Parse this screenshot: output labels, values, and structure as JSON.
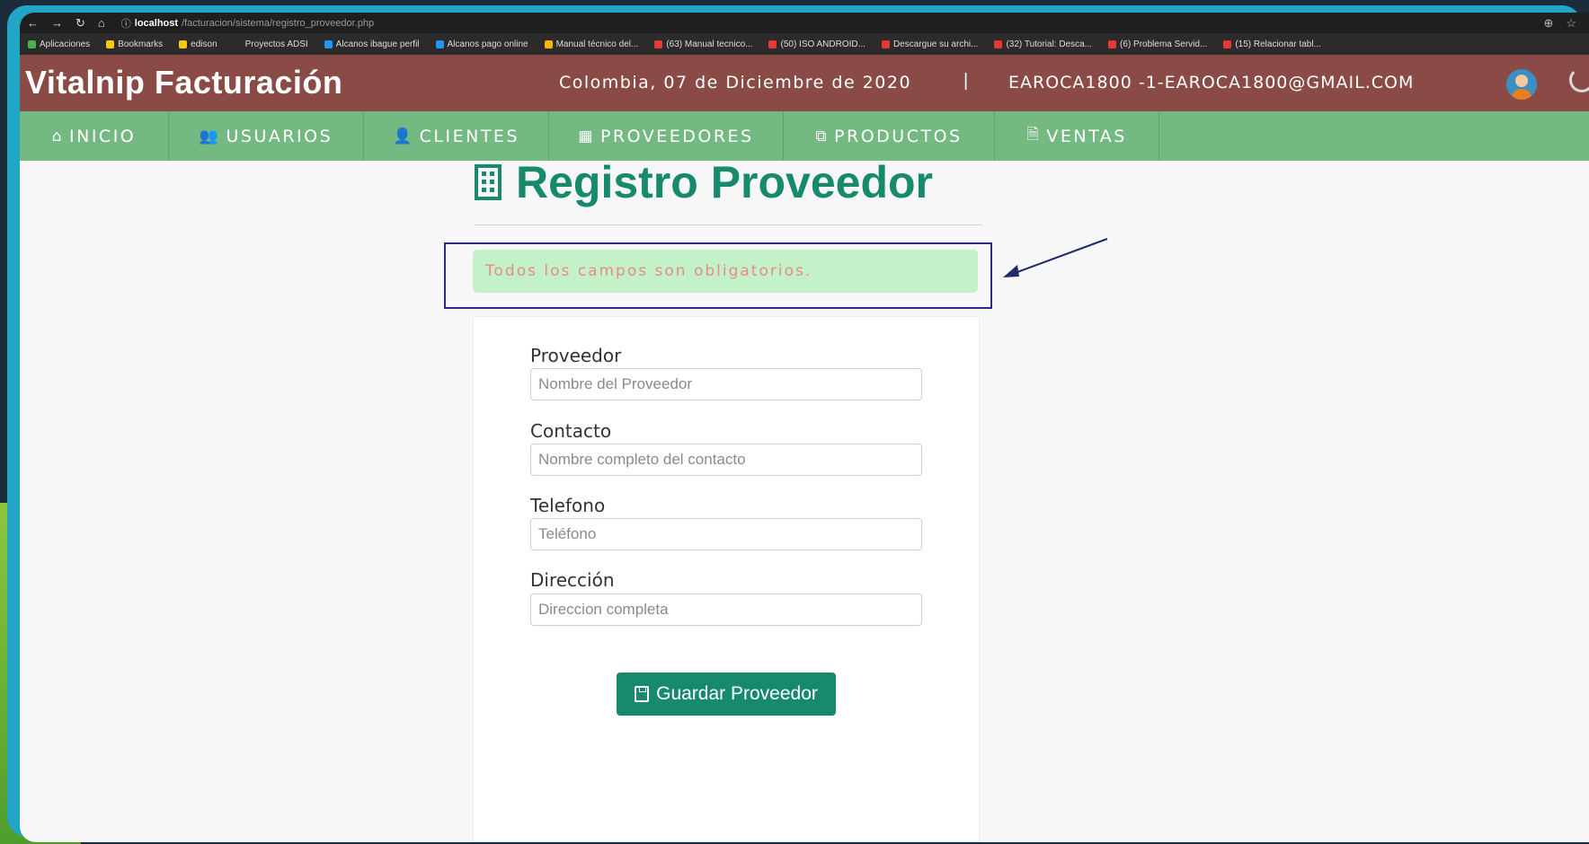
{
  "browser": {
    "host": "localhost",
    "path": "/facturacion/sistema/registro_proveedor.php",
    "bookmarks": [
      {
        "label": "Aplicaciones",
        "color": "#4caf50"
      },
      {
        "label": "Bookmarks",
        "color": "#f9c80e"
      },
      {
        "label": "edison",
        "color": "#f9c80e"
      },
      {
        "label": "Proyectos ADSI",
        "color": "#2b2b2b"
      },
      {
        "label": "Alcanos ibague perfil",
        "color": "#2196f3"
      },
      {
        "label": "Alcanos pago online",
        "color": "#2196f3"
      },
      {
        "label": "Manual técnico del...",
        "color": "#ffb300"
      },
      {
        "label": "(63) Manual tecnico...",
        "color": "#e53935"
      },
      {
        "label": "(50) ISO ANDROID...",
        "color": "#e53935"
      },
      {
        "label": "Descargue su archi...",
        "color": "#e53935"
      },
      {
        "label": "(32) Tutorial: Desca...",
        "color": "#e53935"
      },
      {
        "label": "(6) Problema Servid...",
        "color": "#e53935"
      },
      {
        "label": "(15) Relacionar tabl...",
        "color": "#e53935"
      }
    ]
  },
  "header": {
    "title": "Vitalnip Facturación",
    "date": "Colombia, 07 de Diciembre de 2020",
    "separator": "|",
    "user": "EAROCA1800 -1-EAROCA1800@GMAIL.COM"
  },
  "menu": [
    {
      "label": "INICIO",
      "icon": "home-icon",
      "glyph": "⌂"
    },
    {
      "label": "USUARIOS",
      "icon": "users-icon",
      "glyph": "👥"
    },
    {
      "label": "CLIENTES",
      "icon": "user-icon",
      "glyph": "👤"
    },
    {
      "label": "PROVEEDORES",
      "icon": "building-icon",
      "glyph": "▦"
    },
    {
      "label": "PRODUCTOS",
      "icon": "cubes-icon",
      "glyph": "⧉"
    },
    {
      "label": "VENTAS",
      "icon": "file-icon",
      "glyph": "🗎"
    }
  ],
  "page": {
    "title": "Registro Proveedor",
    "alert": "Todos los campos son obligatorios."
  },
  "form": {
    "proveedor_label": "Proveedor",
    "proveedor_placeholder": "Nombre del Proveedor",
    "contacto_label": "Contacto",
    "contacto_placeholder": "Nombre completo del contacto",
    "telefono_label": "Telefono",
    "telefono_placeholder": "Teléfono",
    "direccion_label": "Dirección",
    "direccion_placeholder": "Direccion completa",
    "save_label": "Guardar Proveedor"
  },
  "colors": {
    "header_bg": "#8a4a45",
    "menu_bg": "#74b982",
    "accent": "#178a6e",
    "alert_bg": "#c3f2c9",
    "alert_text": "#e88a8a"
  }
}
